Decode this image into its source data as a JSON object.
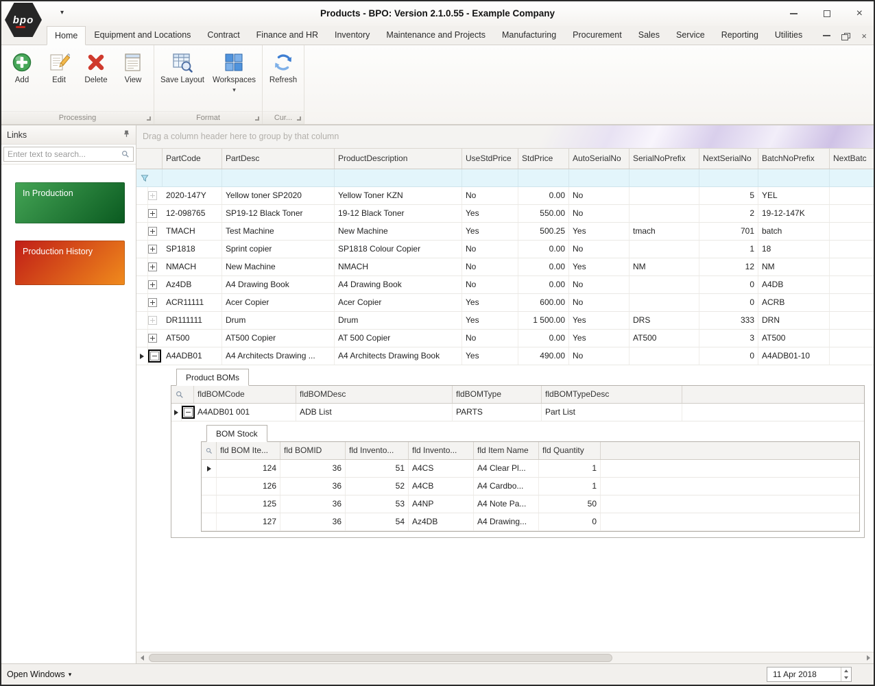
{
  "window": {
    "title": "Products - BPO: Version 2.1.0.55 - Example Company",
    "logo_text": "bpo"
  },
  "menu_tabs": [
    {
      "label": "Home",
      "active": true
    },
    {
      "label": "Equipment and Locations",
      "active": false
    },
    {
      "label": "Contract",
      "active": false
    },
    {
      "label": "Finance and HR",
      "active": false
    },
    {
      "label": "Inventory",
      "active": false
    },
    {
      "label": "Maintenance and Projects",
      "active": false
    },
    {
      "label": "Manufacturing",
      "active": false
    },
    {
      "label": "Procurement",
      "active": false
    },
    {
      "label": "Sales",
      "active": false
    },
    {
      "label": "Service",
      "active": false
    },
    {
      "label": "Reporting",
      "active": false
    },
    {
      "label": "Utilities",
      "active": false
    }
  ],
  "ribbon": {
    "groups": [
      {
        "name": "Processing",
        "buttons": [
          {
            "label": "Add",
            "icon": "add-icon",
            "dropdown": false
          },
          {
            "label": "Edit",
            "icon": "edit-icon",
            "dropdown": false
          },
          {
            "label": "Delete",
            "icon": "delete-icon",
            "dropdown": false
          },
          {
            "label": "View",
            "icon": "view-icon",
            "dropdown": false
          }
        ]
      },
      {
        "name": "Format",
        "buttons": [
          {
            "label": "Save Layout",
            "icon": "save-layout-icon",
            "dropdown": false
          },
          {
            "label": "Workspaces",
            "icon": "workspaces-icon",
            "dropdown": true
          }
        ]
      },
      {
        "name": "Cur...",
        "buttons": [
          {
            "label": "Refresh",
            "icon": "refresh-icon",
            "dropdown": false
          }
        ]
      }
    ]
  },
  "links_panel": {
    "title": "Links",
    "search_placeholder": "Enter text to search...",
    "items": [
      {
        "label": "In Production",
        "gradient_start": "#44a455",
        "gradient_end": "#0a5a20"
      },
      {
        "label": "Production History",
        "gradient_start": "#c01d17",
        "gradient_end": "#f08b1c"
      }
    ]
  },
  "grid": {
    "group_hint": "Drag a column header here to group by that column",
    "columns": [
      "PartCode",
      "PartDesc",
      "ProductDescription",
      "UseStdPrice",
      "StdPrice",
      "AutoSerialNo",
      "SerialNoPrefix",
      "NextSerialNo",
      "BatchNoPrefix",
      "NextBatc"
    ],
    "rows": [
      {
        "expand": "plus-faded",
        "selected": false,
        "cells": [
          "2020-147Y",
          "Yellow toner SP2020",
          "Yellow Toner KZN",
          "No",
          "0.00",
          "No",
          "",
          "5",
          "YEL",
          ""
        ]
      },
      {
        "expand": "plus",
        "selected": false,
        "cells": [
          "12-098765",
          "SP19-12 Black Toner",
          "19-12 Black Toner",
          "Yes",
          "550.00",
          "No",
          "",
          "2",
          "19-12-147K",
          ""
        ]
      },
      {
        "expand": "plus",
        "selected": false,
        "cells": [
          "TMACH",
          "Test Machine",
          "New Machine",
          "Yes",
          "500.25",
          "Yes",
          "tmach",
          "701",
          "batch",
          ""
        ]
      },
      {
        "expand": "plus",
        "selected": false,
        "cells": [
          "SP1818",
          "Sprint copier",
          "SP1818 Colour Copier",
          "No",
          "0.00",
          "No",
          "",
          "1",
          "18",
          ""
        ]
      },
      {
        "expand": "plus",
        "selected": false,
        "cells": [
          "NMACH",
          "New Machine",
          "NMACH",
          "No",
          "0.00",
          "Yes",
          "NM",
          "12",
          "NM",
          ""
        ]
      },
      {
        "expand": "plus",
        "selected": false,
        "cells": [
          "Az4DB",
          "A4 Drawing Book",
          "A4 Drawing Book",
          "No",
          "0.00",
          "No",
          "",
          "0",
          "A4DB",
          ""
        ]
      },
      {
        "expand": "plus",
        "selected": false,
        "cells": [
          "ACR11111",
          "Acer Copier",
          "Acer Copier",
          "Yes",
          "600.00",
          "No",
          "",
          "0",
          "ACRB",
          ""
        ]
      },
      {
        "expand": "plus-faded",
        "selected": false,
        "cells": [
          "DR111111",
          "Drum",
          "Drum",
          "Yes",
          "1 500.00",
          "Yes",
          "DRS",
          "333",
          "DRN",
          ""
        ]
      },
      {
        "expand": "plus",
        "selected": false,
        "cells": [
          "AT500",
          "AT500 Copier",
          "AT 500 Copier",
          "No",
          "0.00",
          "Yes",
          "AT500",
          "3",
          "AT500",
          ""
        ]
      },
      {
        "expand": "minus-boxed",
        "selected": true,
        "cells": [
          "A4ADB01",
          "A4 Architects Drawing ...",
          "A4 Architects Drawing Book",
          "Yes",
          "490.00",
          "No",
          "",
          "0",
          "A4ADB01-10",
          ""
        ]
      }
    ]
  },
  "detail_grid": {
    "tab": "Product BOMs",
    "columns": [
      "fldBOMCode",
      "fldBOMDesc",
      "fldBOMType",
      "fldBOMTypeDesc"
    ],
    "rows": [
      {
        "expand": "minus-boxed",
        "selected": true,
        "cells": [
          "A4ADB01 001",
          "ADB List",
          "PARTS",
          "Part List"
        ]
      }
    ]
  },
  "bom_grid": {
    "tab": "BOM Stock",
    "columns": [
      "fld BOM Ite...",
      "fld BOMID",
      "fld Invento...",
      "fld Invento...",
      "fld Item Name",
      "fld Quantity"
    ],
    "rows": [
      {
        "selected": true,
        "cells": [
          "124",
          "36",
          "51",
          "A4CS",
          "A4 Clear Pl...",
          "1"
        ]
      },
      {
        "selected": false,
        "cells": [
          "126",
          "36",
          "52",
          "A4CB",
          "A4 Cardbo...",
          "1"
        ]
      },
      {
        "selected": false,
        "cells": [
          "125",
          "36",
          "53",
          "A4NP",
          "A4 Note Pa...",
          "50"
        ]
      },
      {
        "selected": false,
        "cells": [
          "127",
          "36",
          "54",
          "Az4DB",
          "A4 Drawing...",
          "0"
        ]
      }
    ]
  },
  "status_bar": {
    "open_windows_label": "Open Windows",
    "date_value": "11 Apr 2018"
  }
}
